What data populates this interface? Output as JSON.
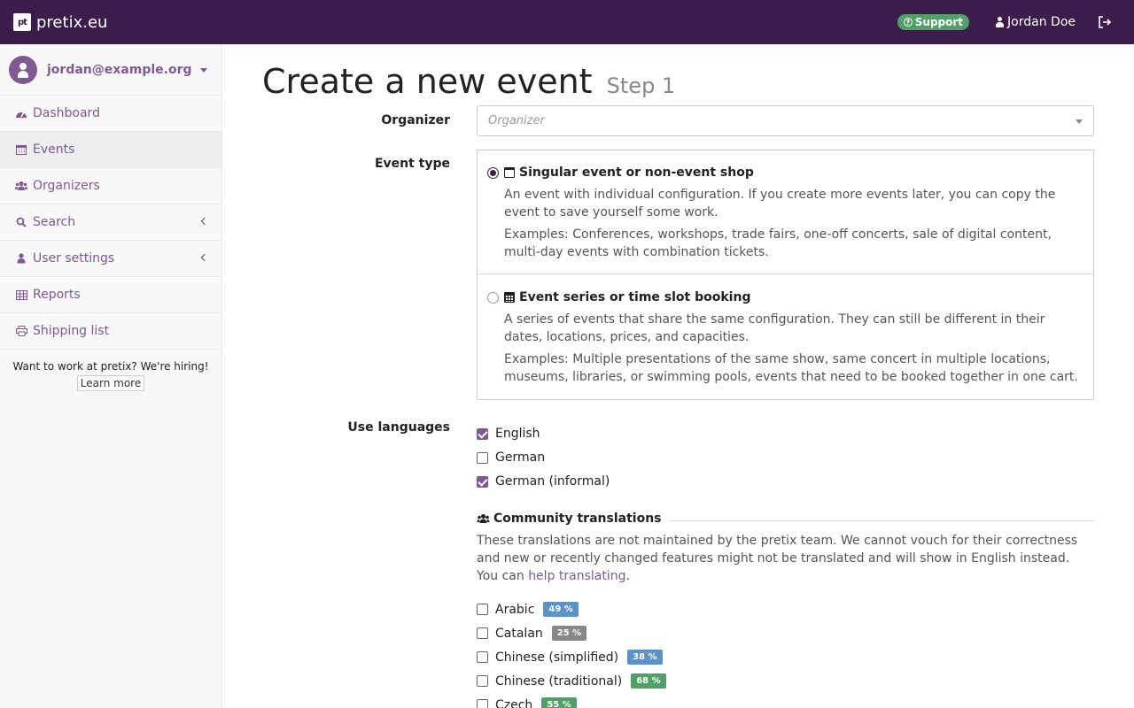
{
  "topbar": {
    "logo": "pt",
    "brand": "pretix.eu",
    "support": "Support",
    "user": "Jordan Doe"
  },
  "sidebar": {
    "account_email": "jordan@example.org",
    "items": [
      {
        "label": "Dashboard",
        "icon": "dashboard-icon"
      },
      {
        "label": "Events",
        "icon": "calendar-icon"
      },
      {
        "label": "Organizers",
        "icon": "users-icon"
      },
      {
        "label": "Search",
        "icon": "search-icon"
      },
      {
        "label": "User settings",
        "icon": "user-icon"
      },
      {
        "label": "Reports",
        "icon": "table-icon"
      },
      {
        "label": "Shipping list",
        "icon": "print-icon"
      }
    ],
    "hiring_text": "Want to work at pretix? We're hiring!",
    "hiring_button": "Learn more"
  },
  "page": {
    "title": "Create a new event",
    "step": "Step 1"
  },
  "form": {
    "organizer_label": "Organizer",
    "organizer_placeholder": "Organizer",
    "event_type_label": "Event type",
    "event_types": [
      {
        "title": "Singular event or non-event shop",
        "desc": "An event with individual configuration. If you create more events later, you can copy the event to save yourself some work.",
        "examples": "Examples: Conferences, workshops, trade fairs, one-off concerts, sale of digital content, multi-day events with combination tickets.",
        "checked": true
      },
      {
        "title": "Event series or time slot booking",
        "desc": "A series of events that share the same configuration. They can still be different in their dates, locations, prices, and capacities.",
        "examples": "Examples: Multiple presentations of the same show, same concert in multiple locations, museums, libraries, or swimming pools, events that need to be booked together in one cart.",
        "checked": false
      }
    ],
    "languages_label": "Use languages",
    "languages": [
      {
        "label": "English",
        "checked": true
      },
      {
        "label": "German",
        "checked": false
      },
      {
        "label": "German (informal)",
        "checked": true
      }
    ],
    "community_title": "Community translations",
    "community_desc": "These translations are not maintained by the pretix team. We cannot vouch for their correctness and new or recently changed features might not be translated and will show in English instead. You can",
    "community_link": "help translating",
    "community_desc_end": ".",
    "community_languages": [
      {
        "label": "Arabic",
        "pct": "49 %",
        "color": "#5b93c7"
      },
      {
        "label": "Catalan",
        "pct": "25 %",
        "color": "#888888"
      },
      {
        "label": "Chinese (simplified)",
        "pct": "38 %",
        "color": "#5b93c7"
      },
      {
        "label": "Chinese (traditional)",
        "pct": "68 %",
        "color": "#50a167"
      },
      {
        "label": "Czech",
        "pct": "55 %",
        "color": "#50a167"
      }
    ]
  },
  "colors": {
    "navbar": "#3b1c4a",
    "accent": "#7f5a91",
    "support": "#50a167"
  }
}
